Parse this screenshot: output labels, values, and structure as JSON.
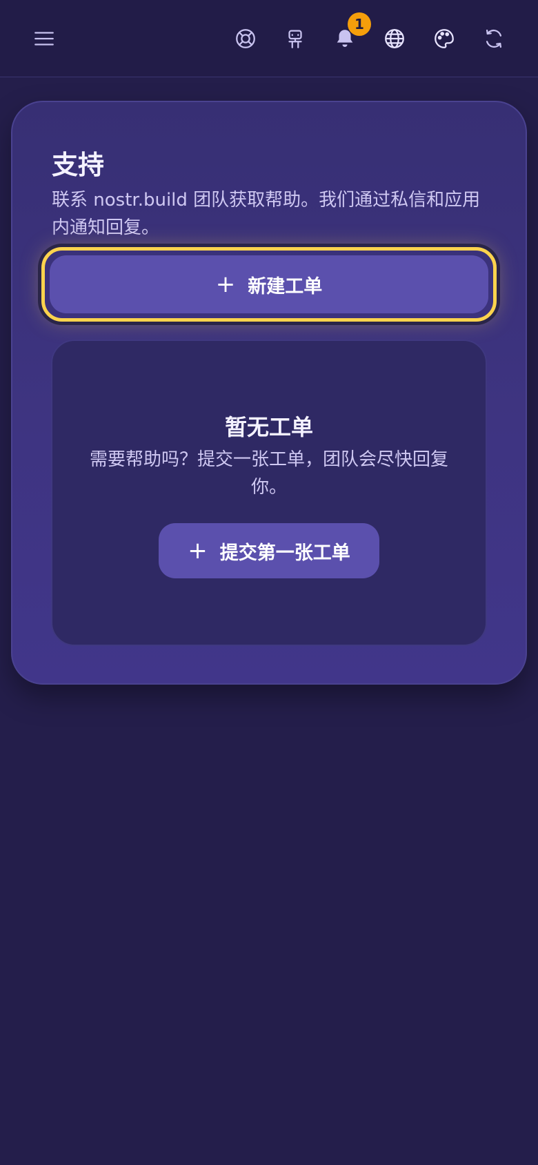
{
  "header": {
    "icons": [
      "menu-icon",
      "lifebuoy-icon",
      "robot-icon",
      "bell-icon",
      "globe-icon",
      "palette-icon",
      "refresh-icon"
    ],
    "notification_count": "1",
    "colors": {
      "background": "#221c48",
      "icon": "#c9c3f0",
      "badge": "#f59e0b"
    }
  },
  "support": {
    "title": "支持",
    "description": "联系 nostr.build 团队获取帮助。我们通过私信和应用内通知回复。",
    "new_ticket_label": "新建工单",
    "new_ticket_icon": "plus-icon"
  },
  "empty_state": {
    "title": "暂无工单",
    "description": "需要帮助吗？提交一张工单，团队会尽快回复你。",
    "submit_first_label": "提交第一张工单",
    "submit_first_icon": "plus-icon"
  },
  "colors": {
    "page_background": "#241e4b",
    "card_background": "#3e3481",
    "button_background": "#5b50ad",
    "focus_ring": "#fcd34d"
  }
}
